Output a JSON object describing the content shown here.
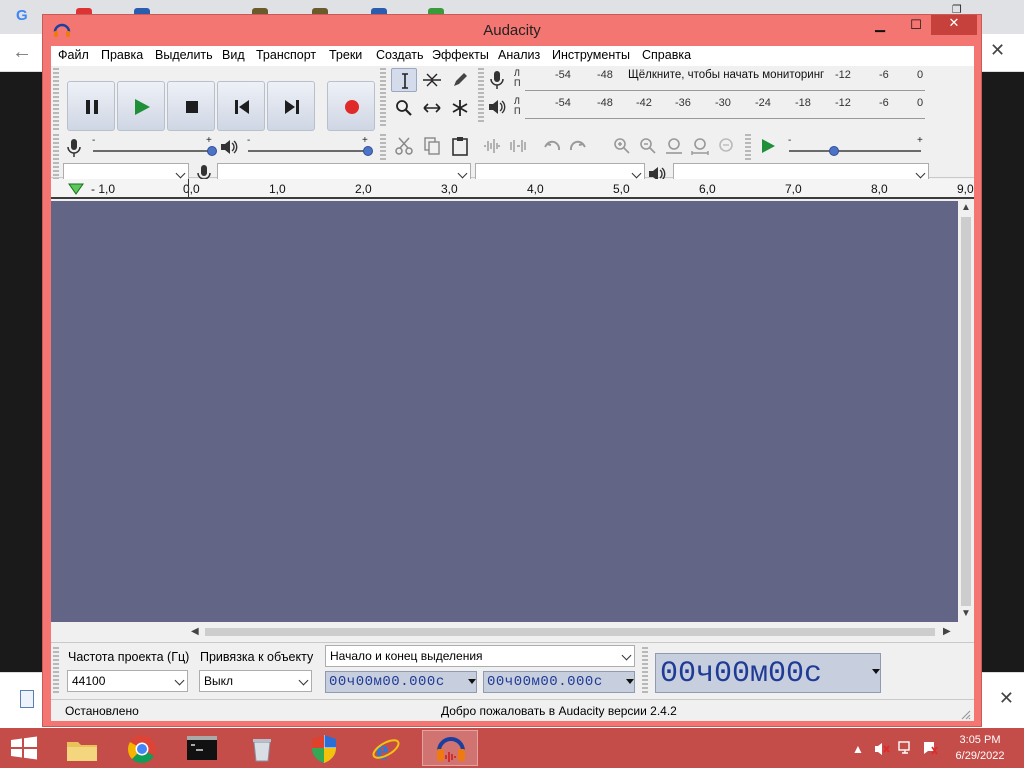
{
  "app": {
    "title": "Audacity"
  },
  "menu": [
    "Файл",
    "Правка",
    "Выделить",
    "Вид",
    "Транспорт",
    "Треки",
    "Создать",
    "Эффекты",
    "Анализ",
    "Инструменты",
    "Справка"
  ],
  "meters": {
    "record": {
      "l": "Л",
      "r": "П",
      "scale_left": [
        "-54",
        "-48"
      ],
      "prompt": "Щёлкните, чтобы начать мониторинг",
      "scale_right": [
        "-12",
        "-6",
        "0"
      ]
    },
    "playback": {
      "l": "Л",
      "r": "П",
      "scale": [
        "-54",
        "-48",
        "-42",
        "-36",
        "-30",
        "-24",
        "-18",
        "-12",
        "-6",
        "0"
      ]
    }
  },
  "sliders": {
    "minus": "-",
    "plus": "+"
  },
  "ruler": {
    "labels": [
      "- 1,0",
      "0,0",
      "1,0",
      "2,0",
      "3,0",
      "4,0",
      "5,0",
      "6,0",
      "7,0",
      "8,0",
      "9,0"
    ]
  },
  "selection": {
    "rate_label": "Частота проекта (Гц)",
    "rate_value": "44100",
    "snap_label": "Привязка к объекту",
    "snap_value": "Выкл",
    "mode_value": "Начало и конец выделения",
    "start_time": "00ч00м00.000с",
    "end_time": "00ч00м00.000с"
  },
  "audio_position": "00ч00м00с",
  "status": {
    "left": "Остановлено",
    "right": "Добро пожаловать в Audacity версии 2.4.2"
  },
  "taskbar": {
    "time": "3:05 PM",
    "date": "6/29/2022"
  },
  "colors": {
    "window_frame": "#f47672",
    "track_bg": "#626586",
    "taskbar": "#c44d4a",
    "time_digits": "#1f3b96"
  }
}
